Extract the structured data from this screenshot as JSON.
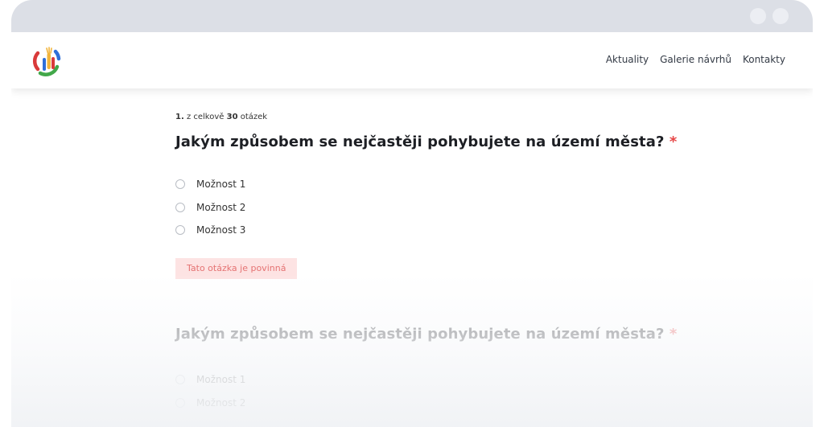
{
  "nav": {
    "links": [
      "Aktuality",
      "Galerie návrhů",
      "Kontakty"
    ]
  },
  "survey": {
    "progress": {
      "current": "1.",
      "middle": " z celkově ",
      "total": "30",
      "suffix": " otázek"
    },
    "questions": [
      {
        "title": "Jakým způsobem se nejčastěji pohybujete na území města?",
        "required_mark": "*",
        "options": [
          "Možnost 1",
          "Možnost 2",
          "Možnost 3"
        ],
        "error": "Tato otázka je povinná"
      },
      {
        "title": "Jakým způsobem se nejčastěji pohybujete na území města?",
        "required_mark": "*",
        "options": [
          "Možnost 1",
          "Možnost 2"
        ]
      }
    ]
  },
  "colors": {
    "required": "#e64545",
    "error_bg": "#fde3e3",
    "error_text": "#e57373",
    "logo": [
      "#d93a3a",
      "#2f6fd8",
      "#42a84a",
      "#f2b43a"
    ]
  },
  "icons": {
    "logo": "raised-hands-logo-icon",
    "radio": "radio-circle-icon"
  }
}
